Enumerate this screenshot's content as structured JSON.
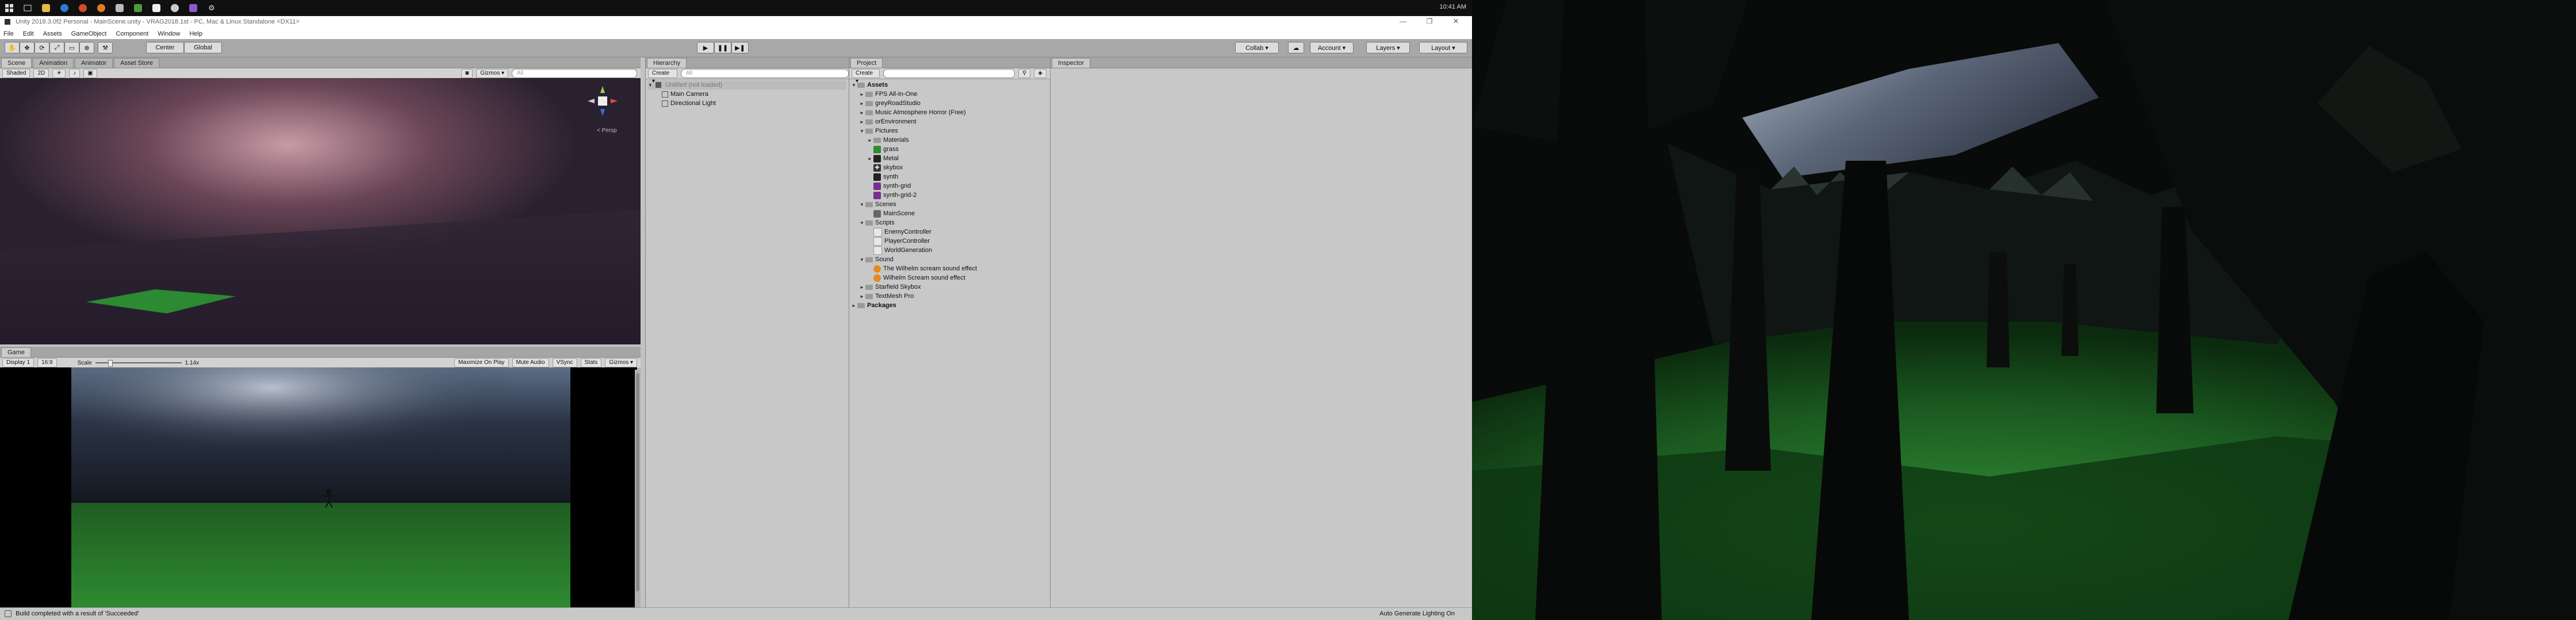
{
  "taskbar": {
    "clock": "10:41 AM",
    "icons": [
      "windows-icon",
      "task-view-icon",
      "file-explorer-icon",
      "edge-icon",
      "chrome-icon",
      "firefox-icon",
      "store-icon",
      "game-icon",
      "unity-icon",
      "steam-icon",
      "visual-studio-icon",
      "settings-icon"
    ]
  },
  "window": {
    "title": "Unity 2018.3.0f2 Personal - MainScene.unity - VRAG2018.1st - PC, Mac & Linux Standalone <DX11>",
    "menus": [
      "File",
      "Edit",
      "Assets",
      "GameObject",
      "Component",
      "Window",
      "Help"
    ]
  },
  "toolbar": {
    "pivot": "Center",
    "space": "Global",
    "collab": "Collab ▾",
    "account": "Account ▾",
    "layers": "Layers ▾",
    "layout": "Layout ▾"
  },
  "scene": {
    "tabs": [
      "Scene",
      "Animation",
      "Animator",
      "Asset Store"
    ],
    "shading": "Shaded",
    "mode2d": "2D",
    "gizmos": "Gizmos ▾",
    "search_placeholder": "All",
    "persp_label": "< Persp"
  },
  "game": {
    "tab": "Game",
    "display": "Display 1",
    "aspect": "16:9",
    "scale_label": "Scale",
    "scale_value": "1.14x",
    "options": [
      "Maximize On Play",
      "Mute Audio",
      "VSync",
      "Stats",
      "Gizmos ▾"
    ]
  },
  "hierarchy": {
    "tab": "Hierarchy",
    "create": "Create ▾",
    "search_placeholder": "All",
    "scene_name": "Untitled (not loaded)",
    "items": [
      "Main Camera",
      "Directional Light"
    ]
  },
  "project": {
    "tab": "Project",
    "create": "Create ▾",
    "tree": [
      {
        "label": "Assets",
        "depth": 0,
        "kind": "root-bold",
        "arrow": "▼"
      },
      {
        "label": "FPS All-In-One",
        "depth": 1,
        "kind": "folder",
        "arrow": "►"
      },
      {
        "label": "greyRoadStudio",
        "depth": 1,
        "kind": "folder",
        "arrow": "►"
      },
      {
        "label": "Music Atmosphere Horror (Free)",
        "depth": 1,
        "kind": "folder",
        "arrow": "►"
      },
      {
        "label": "orEnvironment",
        "depth": 1,
        "kind": "folder",
        "arrow": "►"
      },
      {
        "label": "Pictures",
        "depth": 1,
        "kind": "folder",
        "arrow": "▼"
      },
      {
        "label": "Materials",
        "depth": 2,
        "kind": "folder",
        "arrow": "►"
      },
      {
        "label": "grass",
        "depth": 2,
        "kind": "green",
        "arrow": ""
      },
      {
        "label": "Metal",
        "depth": 2,
        "kind": "dark",
        "arrow": "►"
      },
      {
        "label": "skybox",
        "depth": 2,
        "kind": "sky",
        "arrow": ""
      },
      {
        "label": "synth",
        "depth": 2,
        "kind": "dark",
        "arrow": ""
      },
      {
        "label": "synth-grid",
        "depth": 2,
        "kind": "purple",
        "arrow": ""
      },
      {
        "label": "synth-grid-2",
        "depth": 2,
        "kind": "purple",
        "arrow": ""
      },
      {
        "label": "Scenes",
        "depth": 1,
        "kind": "folder",
        "arrow": "▼"
      },
      {
        "label": "MainScene",
        "depth": 2,
        "kind": "unity",
        "arrow": ""
      },
      {
        "label": "Scripts",
        "depth": 1,
        "kind": "folder",
        "arrow": "▼"
      },
      {
        "label": "EnemyController",
        "depth": 2,
        "kind": "script",
        "arrow": ""
      },
      {
        "label": "PlayerController",
        "depth": 2,
        "kind": "script",
        "arrow": ""
      },
      {
        "label": "WorldGeneration",
        "depth": 2,
        "kind": "script",
        "arrow": ""
      },
      {
        "label": "Sound",
        "depth": 1,
        "kind": "folder",
        "arrow": "▼"
      },
      {
        "label": "The Wilhelm scream sound effect",
        "depth": 2,
        "kind": "audio",
        "arrow": ""
      },
      {
        "label": "Wilhelm Scream sound effect",
        "depth": 2,
        "kind": "audio",
        "arrow": ""
      },
      {
        "label": "Starfield Skybox",
        "depth": 1,
        "kind": "folder",
        "arrow": "►"
      },
      {
        "label": "TextMesh Pro",
        "depth": 1,
        "kind": "folder",
        "arrow": "►"
      },
      {
        "label": "Packages",
        "depth": 0,
        "kind": "root-bold",
        "arrow": "►"
      }
    ]
  },
  "inspector": {
    "tab": "Inspector"
  },
  "status": {
    "message": "Build completed with a result of 'Succeeded'",
    "right": "Auto Generate Lighting On"
  },
  "colors": {
    "folder": "#9a9a9a",
    "grass": "#2e8b2e",
    "purple": "#7a2e8f",
    "audio": "#e58a1f",
    "script": "#e8e8e8"
  }
}
